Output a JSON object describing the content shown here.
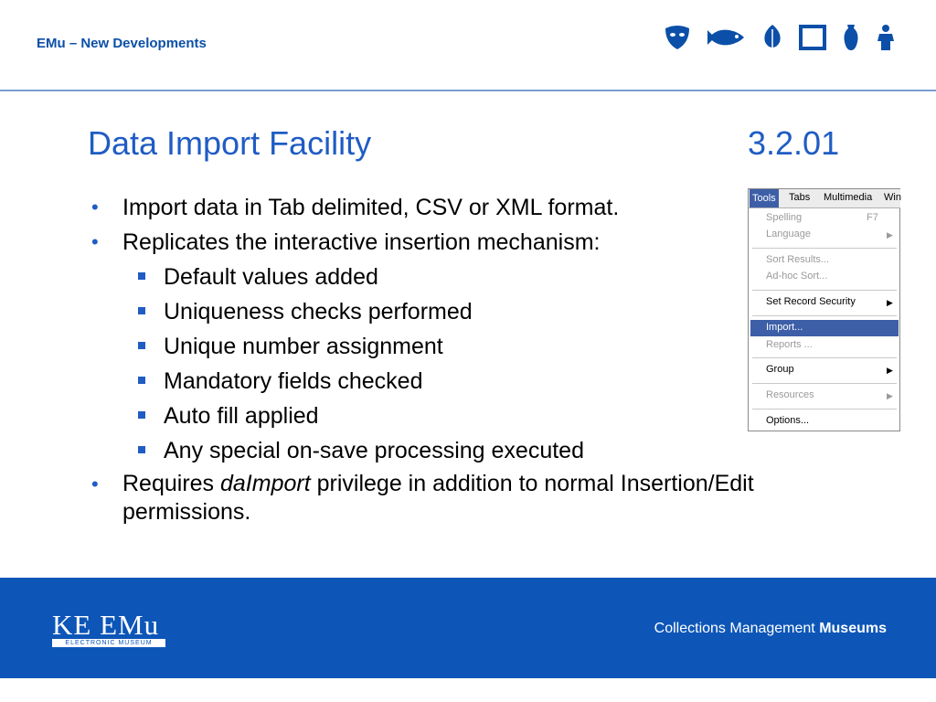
{
  "header": {
    "title": "EMu – New Developments",
    "icons": [
      "mask-icon",
      "fish-icon",
      "leaf-icon",
      "frame-icon",
      "vase-icon",
      "figure-icon"
    ]
  },
  "slide": {
    "title": "Data Import Facility",
    "number": "3.2.01"
  },
  "bullets": {
    "b1": "Import data in Tab delimited, CSV or XML format.",
    "b2": "Replicates the interactive insertion mechanism:",
    "sub": [
      "Default values added",
      "Uniqueness checks performed",
      "Unique number assignment",
      "Mandatory fields checked",
      "Auto fill applied",
      "Any special on-save processing executed"
    ],
    "b3_pre": "Requires ",
    "b3_em": "daImport",
    "b3_post": " privilege in addition to normal Insertion/Edit permissions."
  },
  "menu": {
    "bar": [
      "Tools",
      "Tabs",
      "Multimedia",
      "Win"
    ],
    "items": [
      {
        "label": "Spelling",
        "shortcut": "F7"
      },
      {
        "label": "Language",
        "arrow": "▶"
      },
      {
        "label": "Sort Results..."
      },
      {
        "label": "Ad-hoc Sort..."
      },
      {
        "label": "Set Record Security",
        "arrow": "▶"
      },
      {
        "label": "Import..."
      },
      {
        "label": "Reports ..."
      },
      {
        "label": "Group",
        "arrow": "▶"
      },
      {
        "label": "Resources",
        "arrow": "▶"
      },
      {
        "label": "Options..."
      }
    ]
  },
  "footer": {
    "logo": "KE EMu",
    "logo_sub": "ELECTRONIC MUSEUM",
    "tagline_pre": "Collections Management ",
    "tagline_bold": "Museums"
  },
  "colors": {
    "brand_blue": "#0d56b8",
    "title_blue": "#1f5cc4",
    "menu_highlight": "#3d5fa8"
  }
}
